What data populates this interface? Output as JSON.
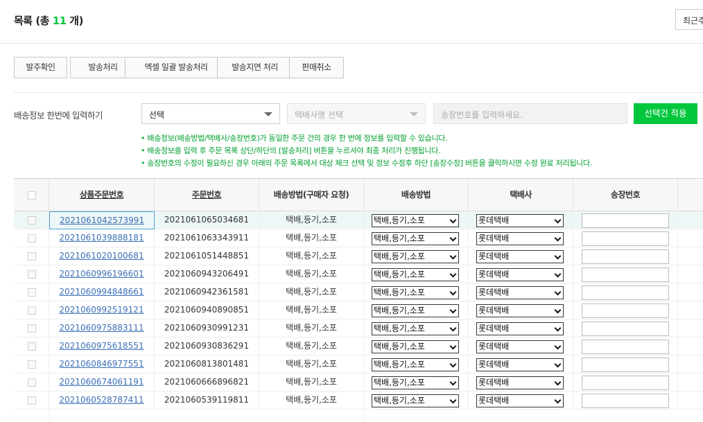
{
  "header": {
    "title_prefix": "목록 (총 ",
    "count": "11",
    "title_suffix": " 개)",
    "sort_label": "최근주"
  },
  "actions": [
    "발주확인",
    "발송처리",
    "엑셀 일괄 발송처리",
    "발송지연 처리",
    "판매취소"
  ],
  "bulk": {
    "label": "배송정보 한번에 입력하기",
    "method_value": "선택",
    "courier_placeholder": "택배사명 선택",
    "invoice_placeholder": "송장번호를 입력하세요.",
    "apply_label": "선택건 적용",
    "notes": [
      "• 배송정보(배송방법/택배사/송장번호)가 동일한 주문 건의 경우 한 번에 정보를 입력할 수 있습니다.",
      "• 배송정보를 입력 후 주문 목록 상단/하단의 [발송처리] 버튼을 누르셔야 최종 처리가 진행됩니다.",
      "• 송장번호의 수정이 필요하신 경우 아래의 주문 목록에서 대상 체크 선택 및 정보 수정후 하단 [송장수정] 버튼을 클릭하시면 수정 완료 처리됩니다."
    ]
  },
  "table": {
    "headers": [
      "상품주문번호",
      "주문번호",
      "배송방법(구매자 요청)",
      "배송방법",
      "택배사",
      "송장번호"
    ],
    "rows": [
      {
        "product_order_no": "2021061042573991",
        "order_no": "2021061065034681",
        "requested_method": "택배,등기,소포",
        "method": "택배,등기,소포",
        "courier": "롯데택배",
        "invoice": ""
      },
      {
        "product_order_no": "2021061039888181",
        "order_no": "2021061063343911",
        "requested_method": "택배,등기,소포",
        "method": "택배,등기,소포",
        "courier": "롯데택배",
        "invoice": ""
      },
      {
        "product_order_no": "2021061020100681",
        "order_no": "2021061051448851",
        "requested_method": "택배,등기,소포",
        "method": "택배,등기,소포",
        "courier": "롯데택배",
        "invoice": ""
      },
      {
        "product_order_no": "2021060996196601",
        "order_no": "2021060943206491",
        "requested_method": "택배,등기,소포",
        "method": "택배,등기,소포",
        "courier": "롯데택배",
        "invoice": ""
      },
      {
        "product_order_no": "2021060994848661",
        "order_no": "2021060942361581",
        "requested_method": "택배,등기,소포",
        "method": "택배,등기,소포",
        "courier": "롯데택배",
        "invoice": ""
      },
      {
        "product_order_no": "2021060992519121",
        "order_no": "2021060940890851",
        "requested_method": "택배,등기,소포",
        "method": "택배,등기,소포",
        "courier": "롯데택배",
        "invoice": ""
      },
      {
        "product_order_no": "2021060975883111",
        "order_no": "2021060930991231",
        "requested_method": "택배,등기,소포",
        "method": "택배,등기,소포",
        "courier": "롯데택배",
        "invoice": ""
      },
      {
        "product_order_no": "2021060975618551",
        "order_no": "2021060930836291",
        "requested_method": "택배,등기,소포",
        "method": "택배,등기,소포",
        "courier": "롯데택배",
        "invoice": ""
      },
      {
        "product_order_no": "2021060846977551",
        "order_no": "2021060813801481",
        "requested_method": "택배,등기,소포",
        "method": "택배,등기,소포",
        "courier": "롯데택배",
        "invoice": ""
      },
      {
        "product_order_no": "2021060674061191",
        "order_no": "2021060666896821",
        "requested_method": "택배,등기,소포",
        "method": "택배,등기,소포",
        "courier": "롯데택배",
        "invoice": ""
      },
      {
        "product_order_no": "2021060528787411",
        "order_no": "2021060539119811",
        "requested_method": "택배,등기,소포",
        "method": "택배,등기,소포",
        "courier": "롯데택배",
        "invoice": ""
      }
    ]
  },
  "colors": {
    "accent": "#00c73c",
    "link": "#3b6fb6",
    "note": "#00a030"
  }
}
